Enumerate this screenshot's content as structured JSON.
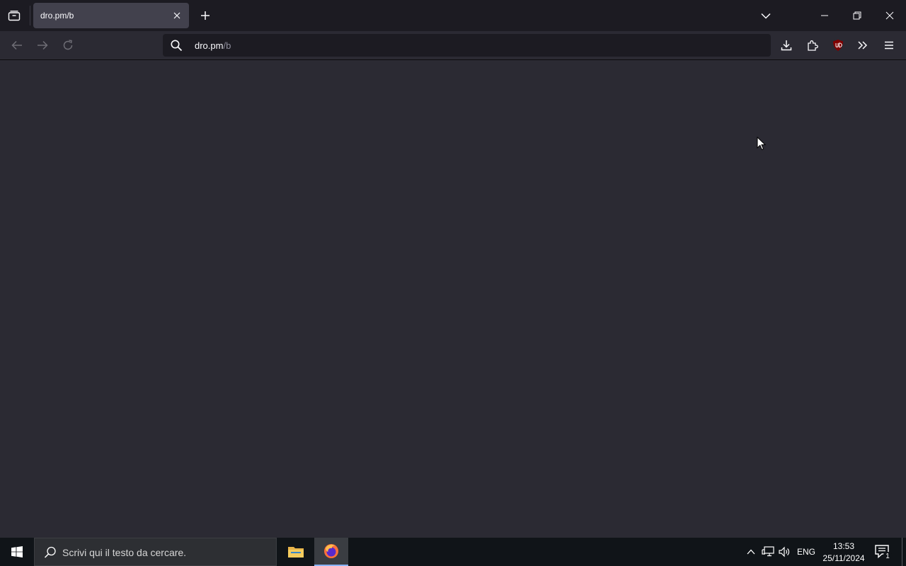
{
  "browser": {
    "tab": {
      "title": "dro.pm/b"
    },
    "urlbar": {
      "host": "dro.pm",
      "path": "/b"
    },
    "colors": {
      "tabbar": "#1c1b22",
      "toolbar": "#2b2a33",
      "page": "#2b2a33",
      "ublock": "#800000"
    }
  },
  "taskbar": {
    "search_placeholder": "Scrivi qui il testo da cercare.",
    "language": "ENG",
    "time": "13:53",
    "date": "25/11/2024",
    "notification_count": "1"
  }
}
